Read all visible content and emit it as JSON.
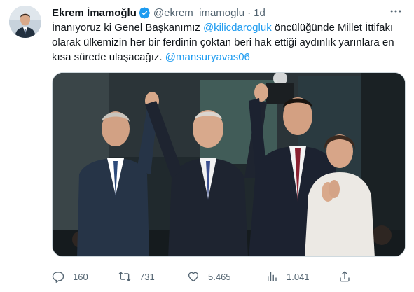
{
  "author": {
    "name": "Ekrem İmamoğlu",
    "handle": "@ekrem_imamoglu",
    "separator": "·",
    "time": "1d"
  },
  "tweet": {
    "text_part1": "İnanıyoruz ki Genel Başkanımız ",
    "mention1": "@kilicdarogluk",
    "text_part2": " öncülüğünde Millet İttifakı olarak ülkemizin her bir ferdinin çoktan beri hak ettiği aydınlık yarınlara en kısa sürede ulaşacağız. ",
    "mention2": "@mansuryavas06"
  },
  "actions": {
    "replies": "160",
    "retweets": "731",
    "likes": "5.465",
    "views": "1.041"
  },
  "colors": {
    "accent": "#1d9bf0",
    "secondary_text": "#536471"
  },
  "icons": [
    "verified-badge-icon",
    "more-options-icon",
    "reply-icon",
    "retweet-icon",
    "like-icon",
    "views-icon",
    "share-icon"
  ]
}
